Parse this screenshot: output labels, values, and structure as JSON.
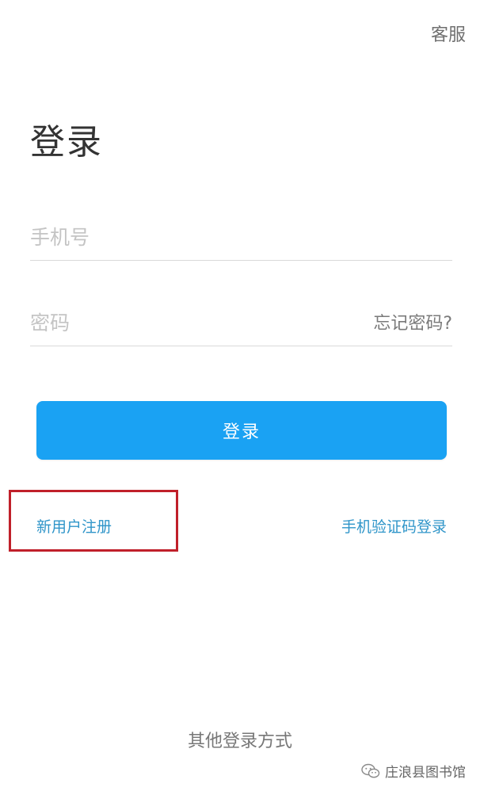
{
  "header": {
    "service_label": "客服"
  },
  "page": {
    "title": "登录"
  },
  "form": {
    "phone": {
      "value": "",
      "placeholder": "手机号"
    },
    "password": {
      "value": "",
      "placeholder": "密码"
    },
    "forgot_password_label": "忘记密码?",
    "login_button_label": "登录"
  },
  "links": {
    "register_label": "新用户注册",
    "sms_login_label": "手机验证码登录",
    "other_login_label": "其他登录方式"
  },
  "watermark": {
    "source_label": "庄浪县图书馆",
    "icon": "wechat-icon"
  },
  "colors": {
    "primary_button": "#1aa2f3",
    "link": "#2f95c9",
    "annotation_box": "#c0202a"
  }
}
